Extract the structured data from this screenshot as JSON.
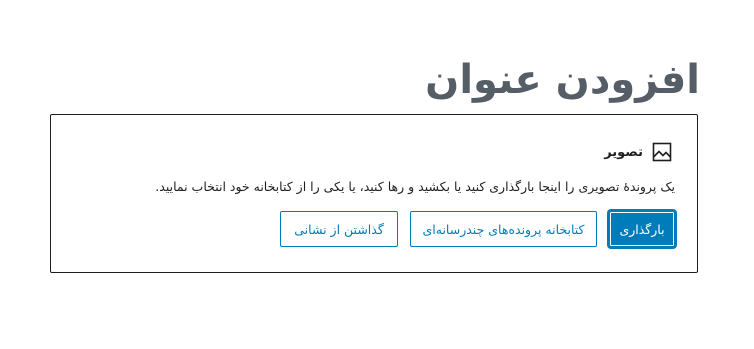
{
  "editor": {
    "post_title": "افزودن عنوان"
  },
  "image_block": {
    "title": "تصویر",
    "icon": "image-icon",
    "instructions": "یک پروندهٔ تصویری را اینجا بارگذاری کنید یا بکشید و رها کنید، یا یکی را از کتابخانه خود انتخاب نمایید.",
    "buttons": {
      "upload": "بارگذاری",
      "media_library": "کتابخانه پرونده‌های چندرسانه‌ای",
      "insert_from_url": "گذاشتن از نشانی"
    }
  },
  "colors": {
    "accent": "#007cba",
    "title": "#555d66",
    "border": "#1e1e1e"
  }
}
